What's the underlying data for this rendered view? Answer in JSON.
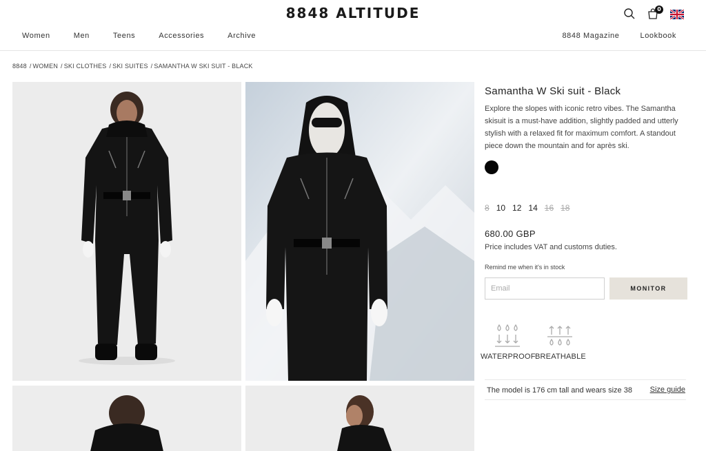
{
  "header": {
    "logo": "8848 ALTITUDE",
    "cart_count": "0",
    "nav_left": [
      "Women",
      "Men",
      "Teens",
      "Accessories",
      "Archive"
    ],
    "nav_right": [
      "8848 Magazine",
      "Lookbook"
    ]
  },
  "breadcrumb": [
    "8848",
    "WOMEN",
    "SKI CLOTHES",
    "SKI SUITES",
    "SAMANTHA W SKI SUIT - BLACK"
  ],
  "product": {
    "title": "Samantha W Ski suit - Black",
    "description": "Explore the slopes with iconic retro vibes. The Samantha skisuit is a must-have addition, slightly padded and utterly stylish with a relaxed fit for maximum comfort. A standout piece down the mountain and for après ski.",
    "color_swatch": "#050505",
    "sizes": [
      {
        "label": "8",
        "available": false
      },
      {
        "label": "10",
        "available": true
      },
      {
        "label": "12",
        "available": true
      },
      {
        "label": "14",
        "available": true
      },
      {
        "label": "16",
        "available": false
      },
      {
        "label": "18",
        "available": false
      }
    ],
    "price": "680.00 GBP",
    "vat_note": "Price includes VAT and customs duties.",
    "remind_label": "Remind me when it's in stock",
    "email_placeholder": "Email",
    "monitor_label": "MONITOR",
    "features": [
      "WATERPROOF",
      "BREATHABLE"
    ],
    "model_note": "The model is 176 cm tall and wears size 38",
    "size_guide": "Size guide"
  },
  "colors": {
    "accent_button": "#e6e2db",
    "text": "#222222"
  }
}
